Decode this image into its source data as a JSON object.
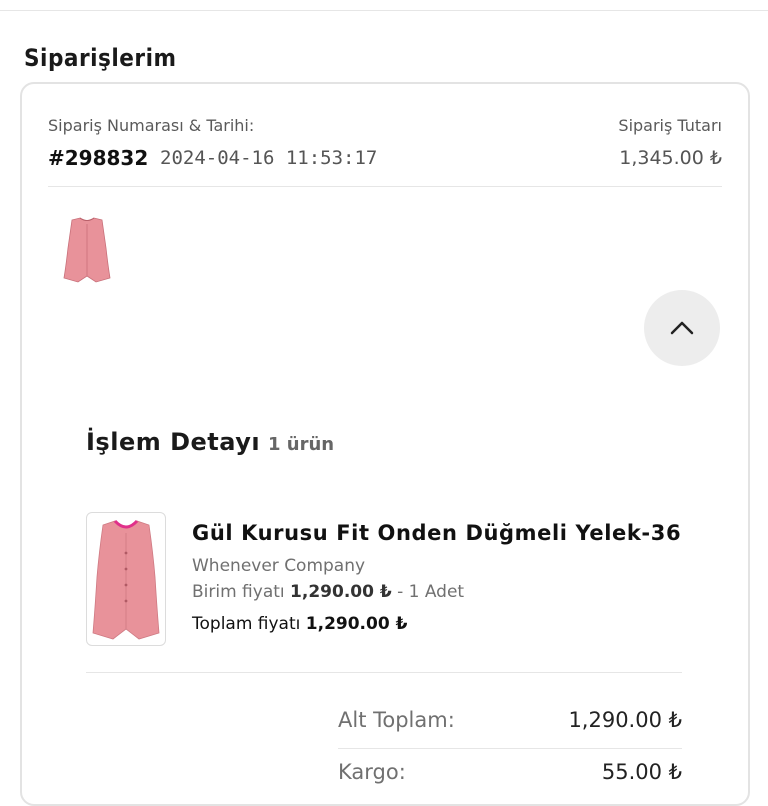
{
  "page": {
    "title": "Siparişlerim"
  },
  "order": {
    "number_label": "Sipariş Numarası & Tarihi:",
    "amount_label": "Sipariş Tutarı",
    "number": "#298832",
    "date": "2024-04-16 11:53:17",
    "amount": "1,345.00 ₺"
  },
  "details": {
    "title": "İşlem Detayı",
    "count": "1 ürün",
    "item": {
      "name": "Gül Kurusu Fit Onden Düğmeli Yelek-36",
      "brand": "Whenever Company",
      "unit_label": "Birim fiyatı",
      "unit_price": "1,290.00 ₺",
      "qty": "- 1 Adet",
      "total_label": "Toplam fiyatı",
      "total_price": "1,290.00 ₺"
    }
  },
  "summary": {
    "subtotal_label": "Alt Toplam:",
    "subtotal_value": "1,290.00 ₺",
    "shipping_label": "Kargo:",
    "shipping_value": "55.00 ₺"
  },
  "icons": {
    "collapse": "chevron-up-icon"
  },
  "colors": {
    "product": "#e8929a",
    "button_bg": "#ededed"
  }
}
